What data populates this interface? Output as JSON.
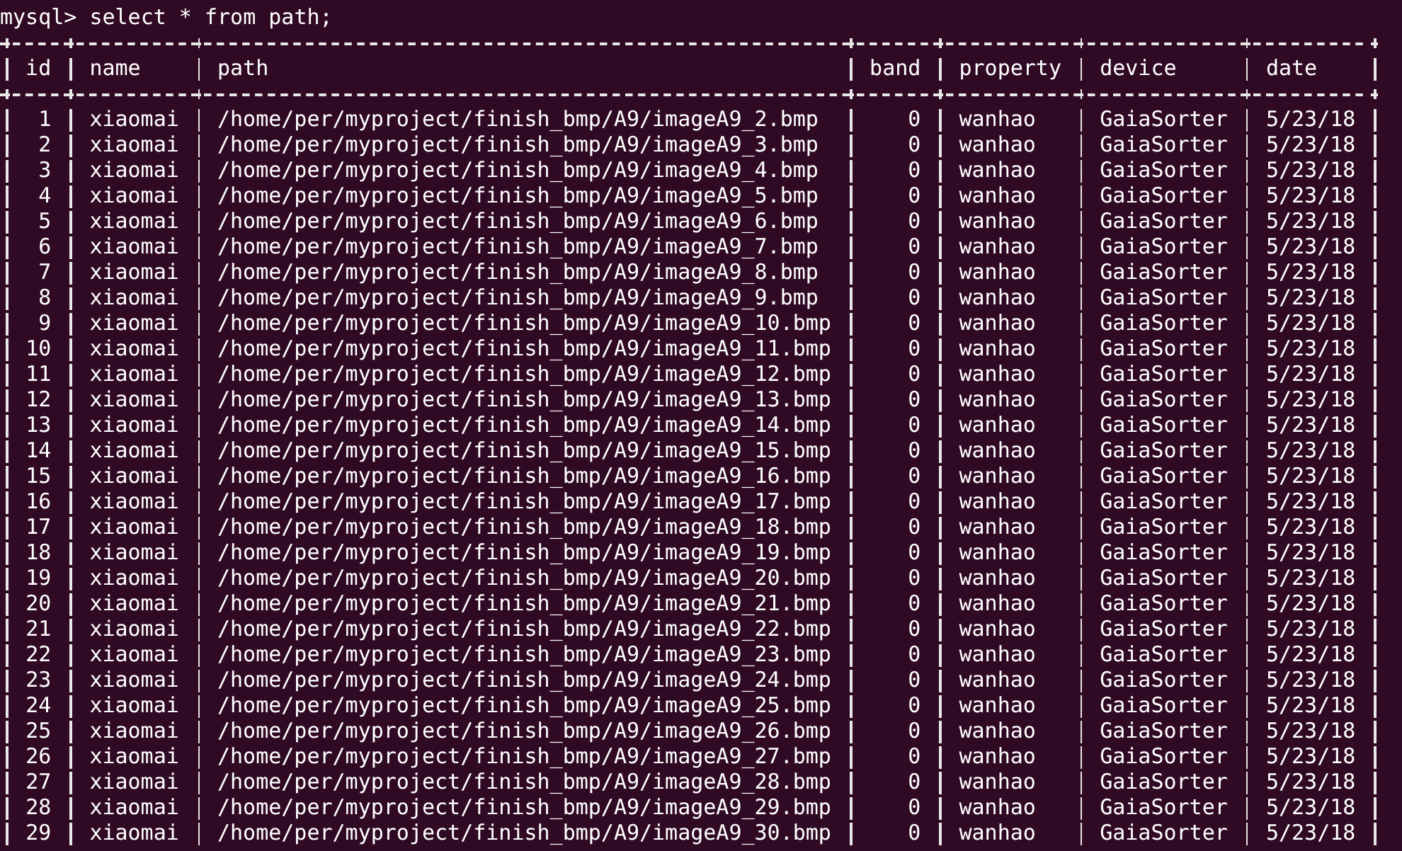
{
  "prompt": "mysql> select * from path;",
  "table": {
    "columns": [
      {
        "label": "id",
        "kind": "number"
      },
      {
        "label": "name",
        "kind": "text"
      },
      {
        "label": "path",
        "kind": "text"
      },
      {
        "label": "band",
        "kind": "number"
      },
      {
        "label": "property",
        "kind": "text"
      },
      {
        "label": "device",
        "kind": "text"
      },
      {
        "label": "date",
        "kind": "text"
      }
    ],
    "rows": [
      [
        "1",
        "xiaomai",
        "/home/per/myproject/finish_bmp/A9/imageA9_2.bmp",
        "0",
        "wanhao",
        "GaiaSorter",
        "5/23/18"
      ],
      [
        "2",
        "xiaomai",
        "/home/per/myproject/finish_bmp/A9/imageA9_3.bmp",
        "0",
        "wanhao",
        "GaiaSorter",
        "5/23/18"
      ],
      [
        "3",
        "xiaomai",
        "/home/per/myproject/finish_bmp/A9/imageA9_4.bmp",
        "0",
        "wanhao",
        "GaiaSorter",
        "5/23/18"
      ],
      [
        "4",
        "xiaomai",
        "/home/per/myproject/finish_bmp/A9/imageA9_5.bmp",
        "0",
        "wanhao",
        "GaiaSorter",
        "5/23/18"
      ],
      [
        "5",
        "xiaomai",
        "/home/per/myproject/finish_bmp/A9/imageA9_6.bmp",
        "0",
        "wanhao",
        "GaiaSorter",
        "5/23/18"
      ],
      [
        "6",
        "xiaomai",
        "/home/per/myproject/finish_bmp/A9/imageA9_7.bmp",
        "0",
        "wanhao",
        "GaiaSorter",
        "5/23/18"
      ],
      [
        "7",
        "xiaomai",
        "/home/per/myproject/finish_bmp/A9/imageA9_8.bmp",
        "0",
        "wanhao",
        "GaiaSorter",
        "5/23/18"
      ],
      [
        "8",
        "xiaomai",
        "/home/per/myproject/finish_bmp/A9/imageA9_9.bmp",
        "0",
        "wanhao",
        "GaiaSorter",
        "5/23/18"
      ],
      [
        "9",
        "xiaomai",
        "/home/per/myproject/finish_bmp/A9/imageA9_10.bmp",
        "0",
        "wanhao",
        "GaiaSorter",
        "5/23/18"
      ],
      [
        "10",
        "xiaomai",
        "/home/per/myproject/finish_bmp/A9/imageA9_11.bmp",
        "0",
        "wanhao",
        "GaiaSorter",
        "5/23/18"
      ],
      [
        "11",
        "xiaomai",
        "/home/per/myproject/finish_bmp/A9/imageA9_12.bmp",
        "0",
        "wanhao",
        "GaiaSorter",
        "5/23/18"
      ],
      [
        "12",
        "xiaomai",
        "/home/per/myproject/finish_bmp/A9/imageA9_13.bmp",
        "0",
        "wanhao",
        "GaiaSorter",
        "5/23/18"
      ],
      [
        "13",
        "xiaomai",
        "/home/per/myproject/finish_bmp/A9/imageA9_14.bmp",
        "0",
        "wanhao",
        "GaiaSorter",
        "5/23/18"
      ],
      [
        "14",
        "xiaomai",
        "/home/per/myproject/finish_bmp/A9/imageA9_15.bmp",
        "0",
        "wanhao",
        "GaiaSorter",
        "5/23/18"
      ],
      [
        "15",
        "xiaomai",
        "/home/per/myproject/finish_bmp/A9/imageA9_16.bmp",
        "0",
        "wanhao",
        "GaiaSorter",
        "5/23/18"
      ],
      [
        "16",
        "xiaomai",
        "/home/per/myproject/finish_bmp/A9/imageA9_17.bmp",
        "0",
        "wanhao",
        "GaiaSorter",
        "5/23/18"
      ],
      [
        "17",
        "xiaomai",
        "/home/per/myproject/finish_bmp/A9/imageA9_18.bmp",
        "0",
        "wanhao",
        "GaiaSorter",
        "5/23/18"
      ],
      [
        "18",
        "xiaomai",
        "/home/per/myproject/finish_bmp/A9/imageA9_19.bmp",
        "0",
        "wanhao",
        "GaiaSorter",
        "5/23/18"
      ],
      [
        "19",
        "xiaomai",
        "/home/per/myproject/finish_bmp/A9/imageA9_20.bmp",
        "0",
        "wanhao",
        "GaiaSorter",
        "5/23/18"
      ],
      [
        "20",
        "xiaomai",
        "/home/per/myproject/finish_bmp/A9/imageA9_21.bmp",
        "0",
        "wanhao",
        "GaiaSorter",
        "5/23/18"
      ],
      [
        "21",
        "xiaomai",
        "/home/per/myproject/finish_bmp/A9/imageA9_22.bmp",
        "0",
        "wanhao",
        "GaiaSorter",
        "5/23/18"
      ],
      [
        "22",
        "xiaomai",
        "/home/per/myproject/finish_bmp/A9/imageA9_23.bmp",
        "0",
        "wanhao",
        "GaiaSorter",
        "5/23/18"
      ],
      [
        "23",
        "xiaomai",
        "/home/per/myproject/finish_bmp/A9/imageA9_24.bmp",
        "0",
        "wanhao",
        "GaiaSorter",
        "5/23/18"
      ],
      [
        "24",
        "xiaomai",
        "/home/per/myproject/finish_bmp/A9/imageA9_25.bmp",
        "0",
        "wanhao",
        "GaiaSorter",
        "5/23/18"
      ],
      [
        "25",
        "xiaomai",
        "/home/per/myproject/finish_bmp/A9/imageA9_26.bmp",
        "0",
        "wanhao",
        "GaiaSorter",
        "5/23/18"
      ],
      [
        "26",
        "xiaomai",
        "/home/per/myproject/finish_bmp/A9/imageA9_27.bmp",
        "0",
        "wanhao",
        "GaiaSorter",
        "5/23/18"
      ],
      [
        "27",
        "xiaomai",
        "/home/per/myproject/finish_bmp/A9/imageA9_28.bmp",
        "0",
        "wanhao",
        "GaiaSorter",
        "5/23/18"
      ],
      [
        "28",
        "xiaomai",
        "/home/per/myproject/finish_bmp/A9/imageA9_29.bmp",
        "0",
        "wanhao",
        "GaiaSorter",
        "5/23/18"
      ],
      [
        "29",
        "xiaomai",
        "/home/per/myproject/finish_bmp/A9/imageA9_30.bmp",
        "0",
        "wanhao",
        "GaiaSorter",
        "5/23/18"
      ]
    ]
  }
}
